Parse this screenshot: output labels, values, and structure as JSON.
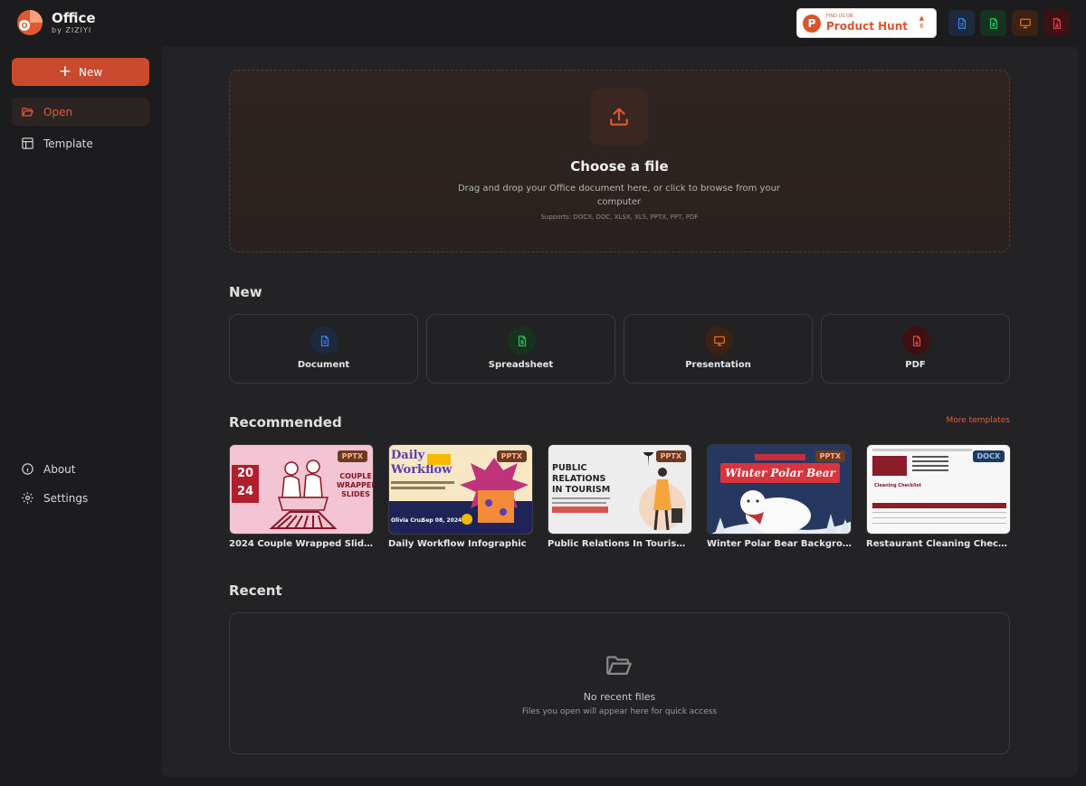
{
  "app": {
    "title": "Office",
    "subtitle": "by ZIZIYI"
  },
  "sidebar": {
    "new_label": "New",
    "items": [
      {
        "label": "Open",
        "icon": "folder-open-icon",
        "active": true
      },
      {
        "label": "Template",
        "icon": "layout-icon",
        "active": false
      }
    ],
    "bottom_items": [
      {
        "label": "About",
        "icon": "info-icon"
      },
      {
        "label": "Settings",
        "icon": "gear-icon"
      }
    ]
  },
  "header": {
    "product_hunt": {
      "small": "FIND US ON",
      "big": "Product Hunt",
      "votes": "6"
    },
    "quick_icons": [
      {
        "name": "document-icon",
        "color": "#3b82f6"
      },
      {
        "name": "spreadsheet-icon",
        "color": "#22c55e"
      },
      {
        "name": "presentation-icon",
        "color": "#f97316"
      },
      {
        "name": "pdf-icon",
        "color": "#ef4444"
      }
    ]
  },
  "upload": {
    "title": "Choose a file",
    "description": "Drag and drop your Office document here, or click to browse from your computer",
    "supports": "Supports: DOCX, DOC, XLSX, XLS, PPTX, PPT, PDF"
  },
  "new_section": {
    "title": "New",
    "cards": [
      {
        "label": "Document",
        "icon": "document-icon",
        "color": "#3b82f6"
      },
      {
        "label": "Spreadsheet",
        "icon": "spreadsheet-icon",
        "color": "#22c55e"
      },
      {
        "label": "Presentation",
        "icon": "presentation-icon",
        "color": "#f97316"
      },
      {
        "label": "PDF",
        "icon": "pdf-icon",
        "color": "#ef4444"
      }
    ]
  },
  "recommended": {
    "title": "Recommended",
    "more_link": "More templates",
    "templates": [
      {
        "caption": "2024 Couple Wrapped Slides",
        "tag": "PPTX",
        "thumb_year_1": "20",
        "thumb_year_2": "24",
        "thumb_title": "COUPLE WRAPPED SLIDES"
      },
      {
        "caption": "Daily Workflow Infographic",
        "tag": "PPTX",
        "thumb_title": "Daily Workflow",
        "thumb_left": "Olivia Cruz",
        "thumb_right": "Sep 08, 2024"
      },
      {
        "caption": "Public Relations In Tourism ...",
        "tag": "PPTX",
        "thumb_title": "PUBLIC RELATIONS IN TOURISM"
      },
      {
        "caption": "Winter Polar Bear Backgrou...",
        "tag": "PPTX",
        "thumb_title": "Winter Polar Bear"
      },
      {
        "caption": "Restaurant Cleaning Checkl...",
        "tag": "DOCX",
        "thumb_title": "Cleaning Checklist"
      }
    ]
  },
  "recent": {
    "title": "Recent",
    "empty_title": "No recent files",
    "empty_desc": "Files you open will appear here for quick access"
  }
}
